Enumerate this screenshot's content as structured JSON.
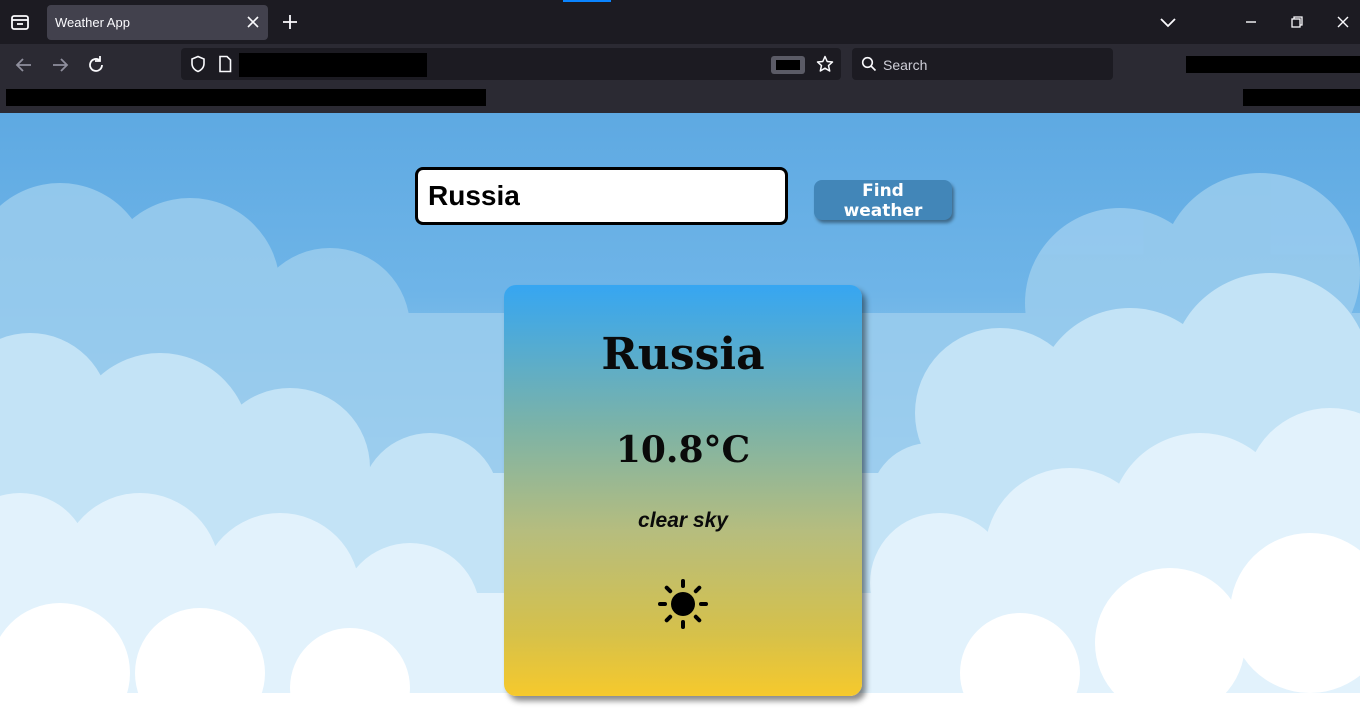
{
  "browser": {
    "tab_title": "Weather App",
    "search_placeholder": "Search",
    "icons": [
      "tab-list-icon",
      "close-icon",
      "plus-icon",
      "chevron-down-icon",
      "minimize-icon",
      "restore-icon",
      "window-close-icon",
      "back-arrow-icon",
      "forward-arrow-icon",
      "reload-icon",
      "shield-icon",
      "page-icon",
      "reader-view-icon",
      "star-icon",
      "search-icon"
    ]
  },
  "app": {
    "search_value": "Russia",
    "find_button_label": "Find weather",
    "card": {
      "city": "Russia",
      "temperature": "10.8°C",
      "description": "clear sky",
      "weather_icon": "sun-icon"
    },
    "colors": {
      "button": "#4286b8",
      "card_top": "#36a6f2",
      "card_bottom": "#f6c92c",
      "sky": "#5ea9e2"
    }
  }
}
